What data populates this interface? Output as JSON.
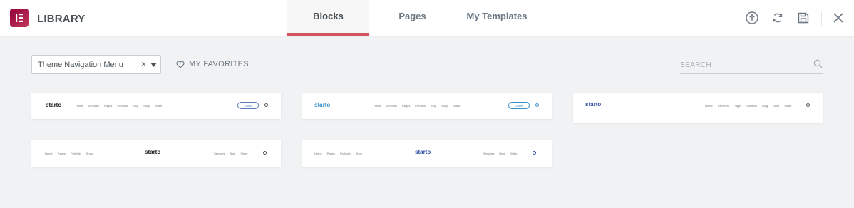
{
  "header": {
    "title": "LIBRARY",
    "tabs": [
      {
        "label": "Blocks",
        "active": true
      },
      {
        "label": "Pages",
        "active": false
      },
      {
        "label": "My Templates",
        "active": false
      }
    ],
    "icons": [
      "import-icon",
      "sync-icon",
      "save-icon",
      "close-icon"
    ],
    "accent_color": "#d3535a",
    "logo_color": "#92003b"
  },
  "toolbar": {
    "category_value": "Theme Navigation Menu",
    "clear_symbol": "×",
    "favorites_label": "MY FAVORITES",
    "search_placeholder": "SEARCH"
  },
  "templates": [
    {
      "logo": "starto",
      "menu": [
        "Home",
        "Services",
        "Pages",
        "Portfolio",
        "Blog",
        "Shop",
        "Slider"
      ],
      "button": "Game"
    },
    {
      "logo": "starto",
      "menu": [
        "Home",
        "Services",
        "Pages",
        "Portfolio",
        "Blog",
        "Shop",
        "Slider"
      ],
      "button": "Game"
    },
    {
      "logo": "starto",
      "menu": [
        "Home",
        "Services",
        "Pages",
        "Portfolio",
        "Blog",
        "Shop",
        "Slider"
      ]
    },
    {
      "logo": "starto",
      "menu_left": [
        "Home",
        "Pages",
        "Portfolio",
        "Shop"
      ],
      "menu_right": [
        "Services",
        "Blog",
        "Slider"
      ]
    },
    {
      "logo": "starto",
      "menu_left": [
        "Home",
        "Pages",
        "Portfolio",
        "Shop"
      ],
      "menu_right": [
        "Services",
        "Blog",
        "Slider"
      ]
    }
  ]
}
